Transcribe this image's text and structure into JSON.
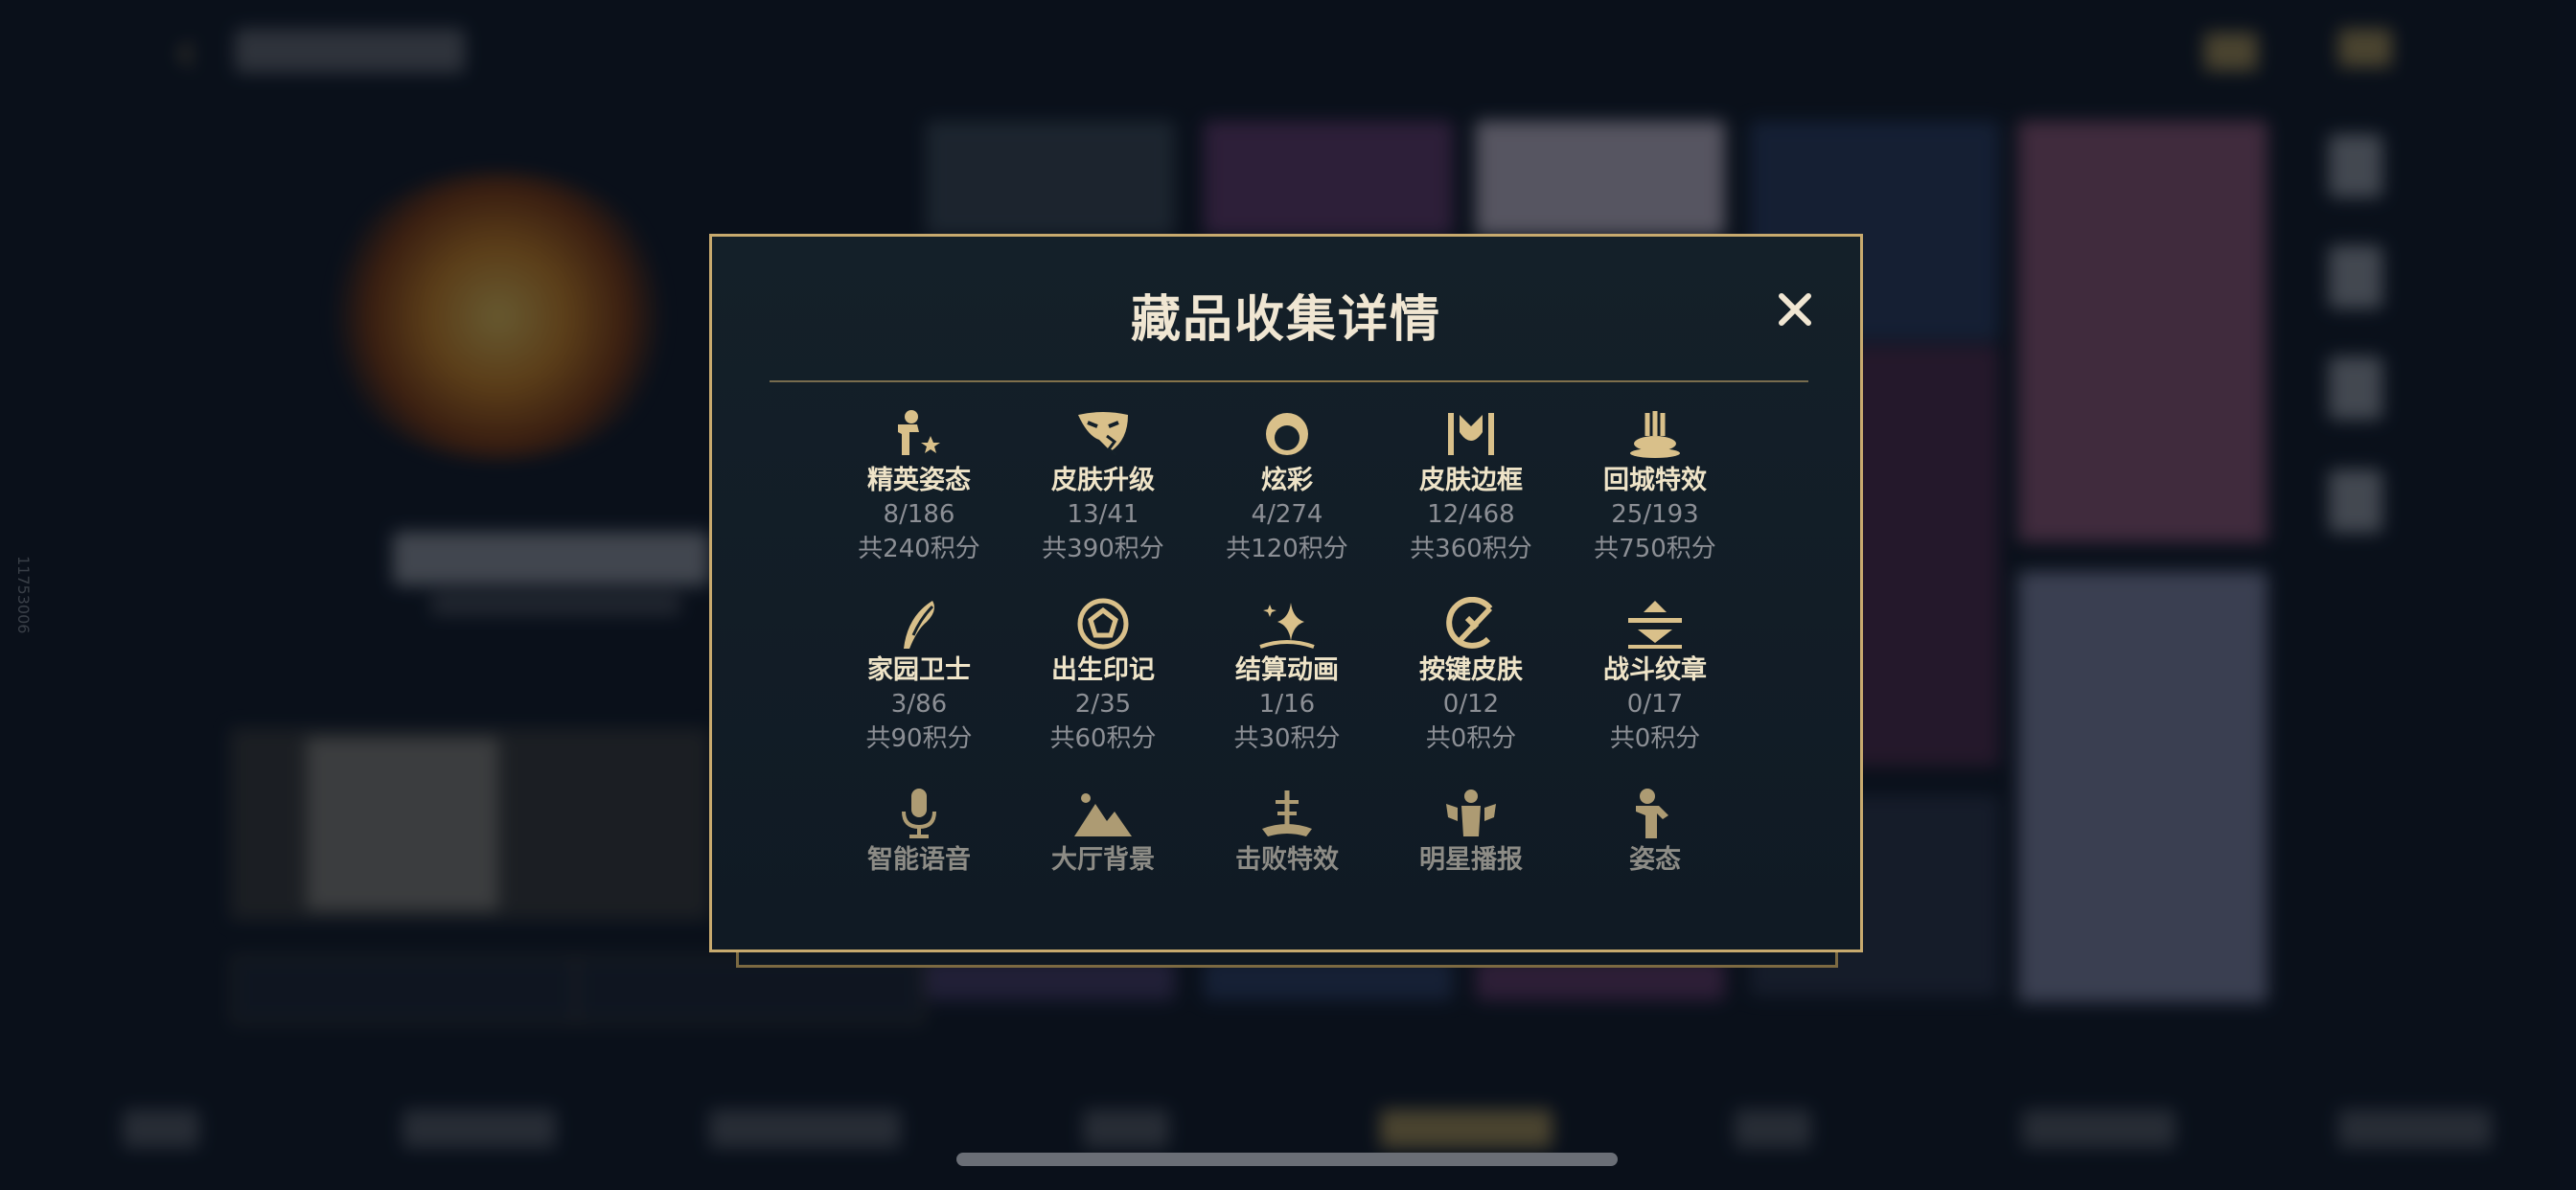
{
  "background": {
    "side_text": "11753006"
  },
  "modal": {
    "title": "藏品收集详情",
    "close_label": "✕",
    "items": [
      {
        "name": "精英姿态",
        "count": "8/186",
        "points": "共240积分",
        "icon": "elite-pose-icon"
      },
      {
        "name": "皮肤升级",
        "count": "13/41",
        "points": "共390积分",
        "icon": "skin-upgrade-icon"
      },
      {
        "name": "炫彩",
        "count": "4/274",
        "points": "共120积分",
        "icon": "chroma-icon"
      },
      {
        "name": "皮肤边框",
        "count": "12/468",
        "points": "共360积分",
        "icon": "skin-border-icon"
      },
      {
        "name": "回城特效",
        "count": "25/193",
        "points": "共750积分",
        "icon": "recall-effect-icon"
      },
      {
        "name": "家园卫士",
        "count": "3/86",
        "points": "共90积分",
        "icon": "home-guard-icon"
      },
      {
        "name": "出生印记",
        "count": "2/35",
        "points": "共60积分",
        "icon": "birth-mark-icon"
      },
      {
        "name": "结算动画",
        "count": "1/16",
        "points": "共30积分",
        "icon": "settlement-animation-icon"
      },
      {
        "name": "按键皮肤",
        "count": "0/12",
        "points": "共0积分",
        "icon": "key-skin-icon"
      },
      {
        "name": "战斗纹章",
        "count": "0/17",
        "points": "共0积分",
        "icon": "battle-emblem-icon"
      },
      {
        "name": "智能语音",
        "icon": "smart-voice-icon"
      },
      {
        "name": "大厅背景",
        "icon": "lobby-background-icon"
      },
      {
        "name": "击败特效",
        "icon": "defeat-effect-icon"
      },
      {
        "name": "明星播报",
        "icon": "star-broadcast-icon"
      },
      {
        "name": "姿态",
        "icon": "pose-icon"
      }
    ]
  },
  "colors": {
    "gold": "#c8aa6e",
    "title_text": "#f0e6d2",
    "muted_text": "#8c8f95",
    "panel_bg": "#142029"
  }
}
